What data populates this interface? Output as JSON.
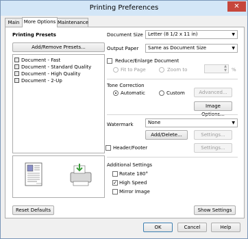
{
  "window": {
    "title": "Printing Preferences",
    "close_glyph": "✕"
  },
  "tabs": [
    {
      "label": "Main"
    },
    {
      "label": "More Options"
    },
    {
      "label": "Maintenance"
    }
  ],
  "presets": {
    "heading": "Printing Presets",
    "add_remove_label": "Add/Remove Presets...",
    "items": [
      {
        "label": "Document - Fast"
      },
      {
        "label": "Document - Standard Quality"
      },
      {
        "label": "Document - High Quality"
      },
      {
        "label": "Document - 2-Up"
      }
    ]
  },
  "document_size": {
    "label": "Document Size",
    "value": "Letter (8 1/2 x 11 in)"
  },
  "output_paper": {
    "label": "Output Paper",
    "value": "Same as Document Size"
  },
  "reduce_enlarge": {
    "label": "Reduce/Enlarge Document",
    "checked": false,
    "fit_to_page_label": "Fit to Page",
    "zoom_to_label": "Zoom to",
    "percent_unit": "%"
  },
  "tone_correction": {
    "heading": "Tone Correction",
    "automatic_label": "Automatic",
    "custom_label": "Custom",
    "advanced_label": "Advanced...",
    "image_options_label": "Image Options..."
  },
  "watermark": {
    "label": "Watermark",
    "value": "None",
    "add_delete_label": "Add/Delete...",
    "settings_label": "Settings..."
  },
  "header_footer": {
    "label": "Header/Footer",
    "checked": false,
    "settings_label": "Settings..."
  },
  "additional_settings": {
    "heading": "Additional Settings",
    "rotate_label": "Rotate 180°",
    "high_speed_label": "High Speed",
    "mirror_image_label": "Mirror Image",
    "checked_glyph": "✓"
  },
  "footer": {
    "reset_defaults_label": "Reset Defaults",
    "show_settings_label": "Show Settings",
    "ok_label": "OK",
    "cancel_label": "Cancel",
    "help_label": "Help"
  },
  "icons": {
    "dropdown_arrow": "▼",
    "spin_up": "▲",
    "spin_down": "▼"
  }
}
